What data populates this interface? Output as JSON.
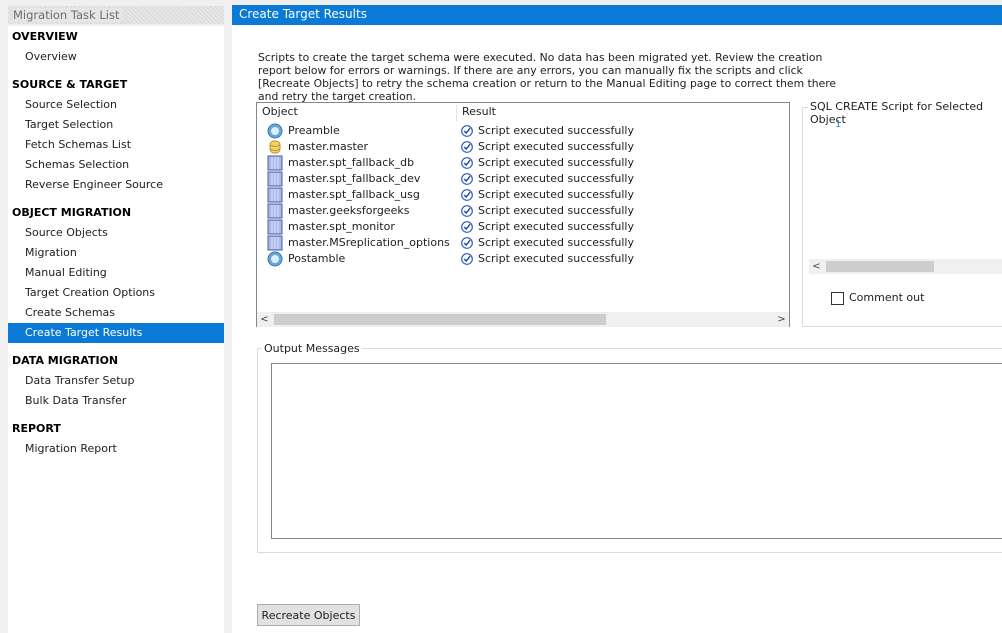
{
  "sidebar": {
    "title": "Migration Task List",
    "sections": [
      {
        "label": "OVERVIEW",
        "items": [
          "Overview"
        ]
      },
      {
        "label": "SOURCE & TARGET",
        "items": [
          "Source Selection",
          "Target Selection",
          "Fetch Schemas List",
          "Schemas Selection",
          "Reverse Engineer Source"
        ]
      },
      {
        "label": "OBJECT MIGRATION",
        "items": [
          "Source Objects",
          "Migration",
          "Manual Editing",
          "Target Creation Options",
          "Create Schemas",
          "Create Target Results"
        ]
      },
      {
        "label": "DATA MIGRATION",
        "items": [
          "Data Transfer Setup",
          "Bulk Data Transfer"
        ]
      },
      {
        "label": "REPORT",
        "items": [
          "Migration Report"
        ]
      }
    ],
    "selected": "Create Target Results"
  },
  "main": {
    "title": "Create Target Results",
    "description": "Scripts to create the target schema were executed. No data has been migrated yet. Review the creation report below for errors or warnings. If there are any errors, you can manually fix the scripts and click [Recreate Objects] to retry the schema creation or return to the Manual Editing page to correct them there and retry the target creation.",
    "table": {
      "columns": [
        "Object",
        "Result"
      ],
      "rows": [
        {
          "icon": "script-icon",
          "object": "Preamble",
          "result": "Script executed successfully"
        },
        {
          "icon": "database-icon",
          "object": "master.master",
          "result": "Script executed successfully"
        },
        {
          "icon": "table-icon",
          "object": "master.spt_fallback_db",
          "result": "Script executed successfully"
        },
        {
          "icon": "table-icon",
          "object": "master.spt_fallback_dev",
          "result": "Script executed successfully"
        },
        {
          "icon": "table-icon",
          "object": "master.spt_fallback_usg",
          "result": "Script executed successfully"
        },
        {
          "icon": "table-icon",
          "object": "master.geeksforgeeks",
          "result": "Script executed successfully"
        },
        {
          "icon": "table-icon",
          "object": "master.spt_monitor",
          "result": "Script executed successfully"
        },
        {
          "icon": "table-icon",
          "object": "master.MSreplication_options",
          "result": "Script executed successfully"
        },
        {
          "icon": "script-icon",
          "object": "Postamble",
          "result": "Script executed successfully"
        }
      ]
    },
    "sql_panel": {
      "title": "SQL CREATE Script for Selected Object",
      "line_number": "1",
      "comment_out_label": "Comment out",
      "comment_out_checked": false
    },
    "output": {
      "title": "Output Messages"
    },
    "recreate_button": "Recreate Objects"
  },
  "colors": {
    "accent": "#0a7ad6"
  }
}
